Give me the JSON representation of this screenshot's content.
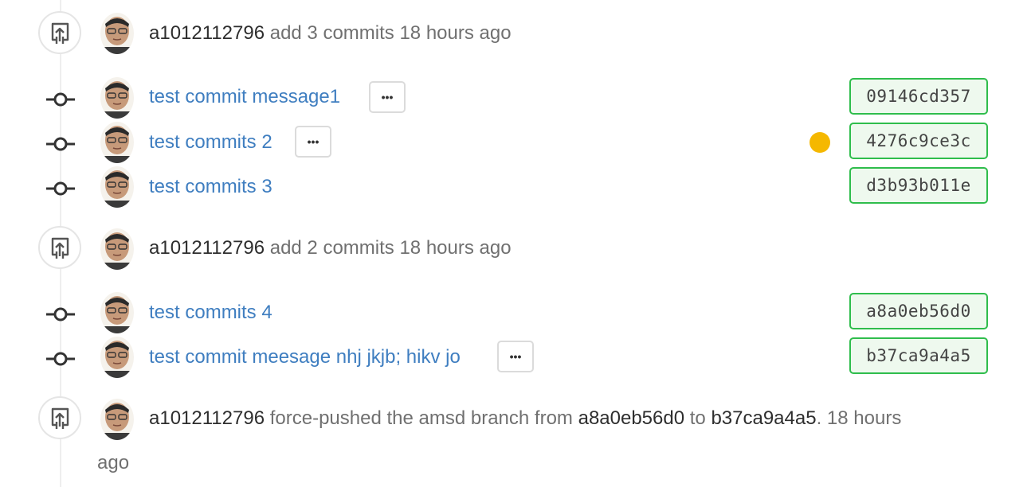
{
  "events": [
    {
      "author": "a1012112796",
      "action": "add 3 commits",
      "time": "18 hours ago"
    },
    {
      "author": "a1012112796",
      "action": "add 2 commits",
      "time": "18 hours ago"
    }
  ],
  "commits": [
    {
      "message": "test commit message1",
      "sha": "09146cd357",
      "more_label": "•••"
    },
    {
      "message": "test commits 2",
      "sha": "4276c9ce3c",
      "more_label": "•••"
    },
    {
      "message": "test commits 3",
      "sha": "d3b93b011e"
    },
    {
      "message": "test commits 4",
      "sha": "a8a0eb56d0"
    },
    {
      "message": "test commit meesage nhj jkjb; hikv jo",
      "sha": "b37ca9a4a5",
      "more_label": "•••"
    }
  ],
  "force_push": {
    "author": "a1012112796",
    "text1": "force-pushed the amsd branch from",
    "from_sha": "a8a0eb56d0",
    "to_word": "to",
    "to_sha": "b37ca9a4a5",
    "dot": ".",
    "time_part1": "18 hours",
    "time_part2": "ago"
  },
  "icons": {
    "push": "repo-push-icon",
    "commit": "git-commit-icon",
    "avatar": "user-avatar",
    "more": "ellipsis-icon"
  },
  "colors": {
    "link": "#3f7ec0",
    "sha_border": "#2fbd4c",
    "sha_bg": "#eef9ee",
    "status_pending": "#f5b800"
  }
}
